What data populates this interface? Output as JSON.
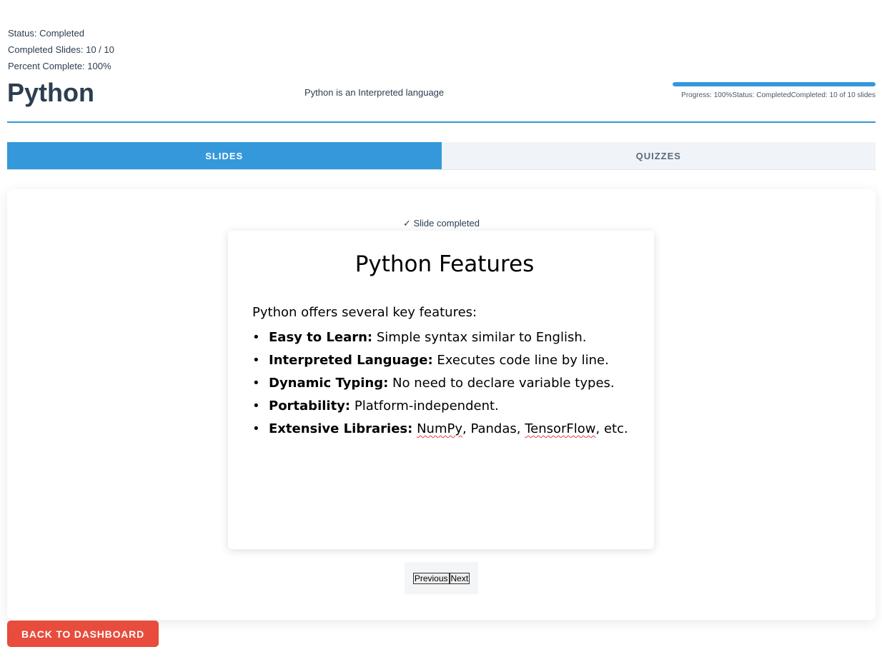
{
  "status": {
    "status_line": "Status: Completed",
    "slides_line": "Completed Slides: 10 / 10",
    "percent_line": "Percent Complete: 100%"
  },
  "header": {
    "title": "Python",
    "description": "Python is an Interpreted language",
    "progress_fraction": 1.0,
    "progress_text": "Progress: 100%Status: CompletedCompleted: 10 of 10 slides"
  },
  "tabs": [
    {
      "label": "SLIDES",
      "active": true
    },
    {
      "label": "QUIZZES",
      "active": false
    }
  ],
  "slide": {
    "status": "✓ Slide completed",
    "title": "Python Features",
    "intro": "Python offers several key features:",
    "bullet_char": "•",
    "bullets": [
      {
        "name": "Easy to Learn:",
        "text": " Simple syntax similar to English."
      },
      {
        "name": "Interpreted Language:",
        "text": " Executes code line by line."
      },
      {
        "name": "Dynamic Typing:",
        "text": " No need to declare variable types."
      },
      {
        "name": "Portability:",
        "text": " Platform-independent."
      },
      {
        "name": "Extensive Libraries:",
        "text_parts": [
          " ",
          "NumPy",
          ", Pandas, ",
          "TensorFlow",
          ", etc."
        ]
      }
    ]
  },
  "nav": {
    "previous_label": "Previous",
    "next_label": "Next"
  },
  "back_button_label": "BACK TO DASHBOARD",
  "colors": {
    "accent": "#3498db",
    "danger": "#e74c3c",
    "heading": "#2c3e50"
  }
}
